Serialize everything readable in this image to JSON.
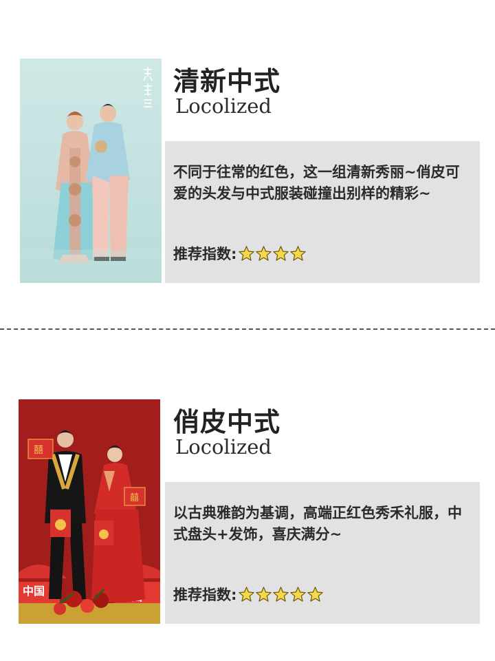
{
  "cards": [
    {
      "title": "清新中式",
      "subtitle": "Locolized",
      "description": "不同于往常的红色，这一组清新秀丽~俏皮可爱的头发与中式服装碰撞出别样的精彩~",
      "rating_label": "推荐指数:",
      "rating_stars": 4,
      "photo_logo_text": "禮 里 三",
      "photo_background": "#c5e3e1"
    },
    {
      "title": "俏皮中式",
      "subtitle": "Locolized",
      "description": "以古典雅韵为基调，高端正红色秀禾礼服，中式盘头+发饰，喜庆满分~",
      "rating_label": "推荐指数:",
      "rating_stars": 5,
      "photo_background": "#a11d1b"
    }
  ],
  "colors": {
    "star_fill": "#f7d84a",
    "star_stroke": "#6b5a12",
    "panel_bg": "#e2e2e2",
    "divider": "#555555"
  },
  "icons": {
    "star": "star-icon"
  }
}
